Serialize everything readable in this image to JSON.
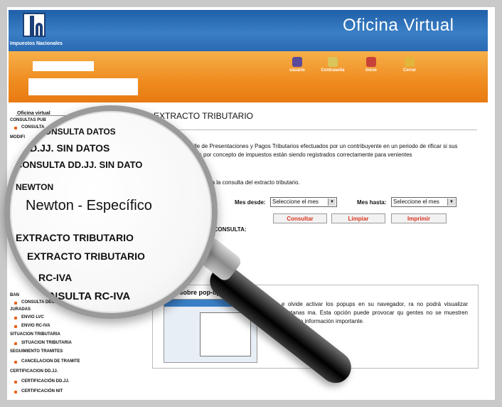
{
  "header": {
    "logo_text": "Impuestos Nacionales",
    "brand_title": "Oficina Virtual",
    "nav": [
      {
        "label": "usuario",
        "icon": "user-icon"
      },
      {
        "label": "Contraseña",
        "icon": "key-icon"
      },
      {
        "label": "Inicio",
        "icon": "home-icon"
      },
      {
        "label": "Cerrar",
        "icon": "close-icon"
      }
    ]
  },
  "sidebar": {
    "title": "Oficina virtual",
    "sections": [
      {
        "label": "CONSULTAS PUB",
        "items": [
          "CONSULTA"
        ]
      },
      {
        "label": "MODIFI",
        "items": []
      },
      {
        "label": "BAN",
        "items": [
          "CONSULTA DECLARACIONES"
        ]
      },
      {
        "label": "JURADAS",
        "items": [
          "ENVIO LVC",
          "ENVIO RC-IVA"
        ]
      },
      {
        "label": "SITUACION TRIBUTARIA",
        "items": [
          "SITUACION TRIBUTARIA"
        ]
      },
      {
        "label": "SEGUIMIENTO TRAMITES",
        "items": [
          "CANCELACION DE TRAMITE"
        ]
      },
      {
        "label": "CERTIFICACION DD.JJ.",
        "items": [
          "CERTIFICACIÓN DD.JJ.",
          "CERTIFICACIÓN NIT"
        ]
      }
    ]
  },
  "main": {
    "title": "EXTRACTO TRIBUTARIO",
    "description": "etalle de Presentaciones y Pagos Tributarios efectuados por un contribuyente en un periodo de rificar si sus pagos por concepto de impuestos están siendo registrados correctamente para venientes",
    "instruction": "para la consulta del extracto tributario.",
    "mes_desde_label": "Mes desde:",
    "mes_desde_value": "Seleccione el mes",
    "mes_hasta_label": "Mes hasta:",
    "mes_hasta_value": "Seleccione el mes",
    "btn_consultar": "Consultar",
    "btn_limpiar": "Limpiar",
    "btn_imprimir": "Imprimir",
    "consulta_label": "LA CONSULTA:"
  },
  "popup": {
    "title": "Nota sobre pop-up",
    "text": "e olvide activar los popups en su navegador, ra no podrá visualizar ventanas ma. Esta opción puede provocar qu gentes no se muestren evitando información importante."
  },
  "lens": {
    "l1": "CONSULTA DATOS",
    "l2": "DD.JJ. SIN DATOS",
    "l3": "CONSULTA DD.JJ. SIN DATO",
    "l4": "NEWTON",
    "l5": "Newton - Específico",
    "l6": "EXTRACTO TRIBUTARIO",
    "l7": "EXTRACTO TRIBUTARIO",
    "l8": "RC-IVA",
    "l9": "CONSULTA RC-IVA"
  },
  "colors": {
    "header_blue": "#2a6ab3",
    "header_orange": "#ef8b1f",
    "button_text": "#d9331c",
    "bullet": "#e8621b"
  }
}
